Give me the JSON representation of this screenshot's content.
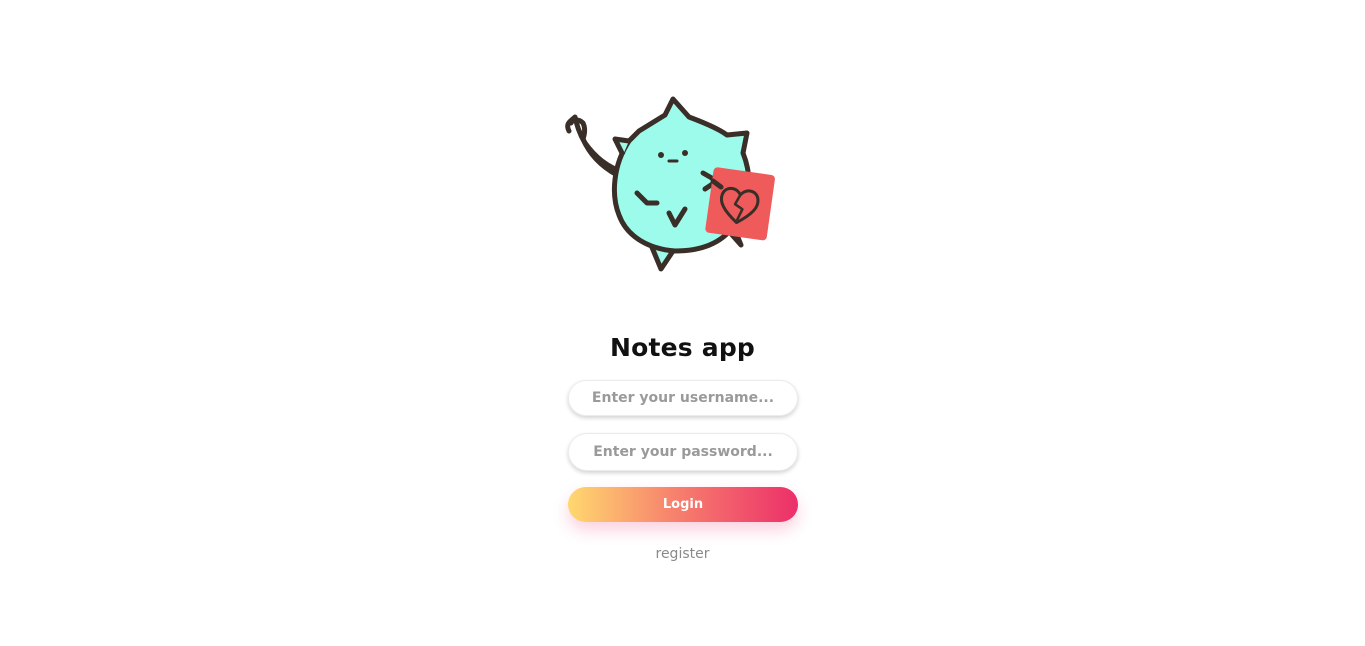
{
  "app": {
    "title": "Notes app"
  },
  "form": {
    "username_placeholder": "Enter your username...",
    "username_value": "",
    "password_placeholder": "Enter your password...",
    "password_value": "",
    "login_label": "Login",
    "register_label": "register"
  },
  "illustration": {
    "icon": "cat-mascot-holding-broken-heart-note",
    "body_color": "#9cfbea",
    "note_color": "#ef5a5a",
    "outline_color": "#3a2e28"
  },
  "colors": {
    "button_gradient_start": "#ffd86f",
    "button_gradient_end": "#ec2f6a",
    "placeholder": "#9a9a9a",
    "link": "#8a8a8a"
  }
}
